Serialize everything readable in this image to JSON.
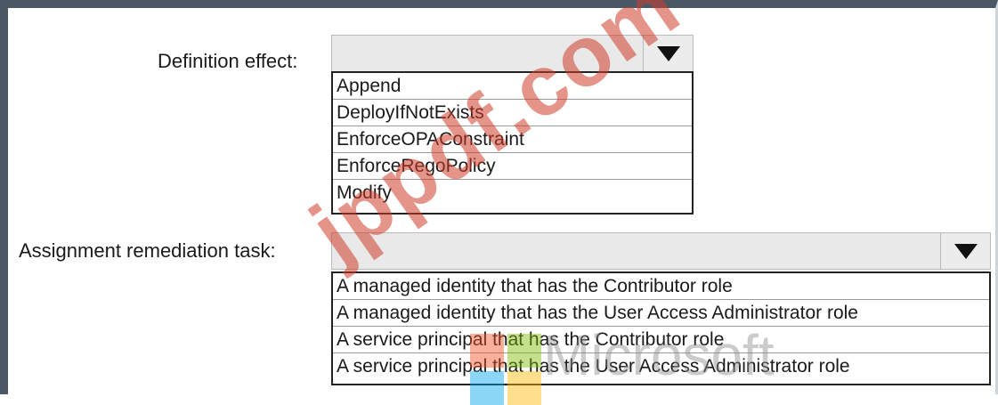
{
  "form": {
    "definition_effect": {
      "label": "Definition effect:",
      "selected": "",
      "options": [
        "Append",
        "DeployIfNotExists",
        "EnforceOPAConstraint",
        "EnforceRegoPolicy",
        "Modify"
      ]
    },
    "assignment_remediation": {
      "label": "Assignment remediation task:",
      "selected": "",
      "options": [
        "A managed identity that has the Contributor role",
        "A managed identity that has the User Access Administrator role",
        "A service principal that has the Contributor role",
        "A service principal that has the User Access Administrator role"
      ]
    }
  },
  "watermarks": {
    "site": "jppdf.com",
    "brand": "Microsoft"
  },
  "colors": {
    "frame": "#4a5866",
    "ms_red": "#f25022",
    "ms_green": "#7fba00",
    "ms_blue": "#00a4ef",
    "ms_yellow": "#ffb900"
  }
}
